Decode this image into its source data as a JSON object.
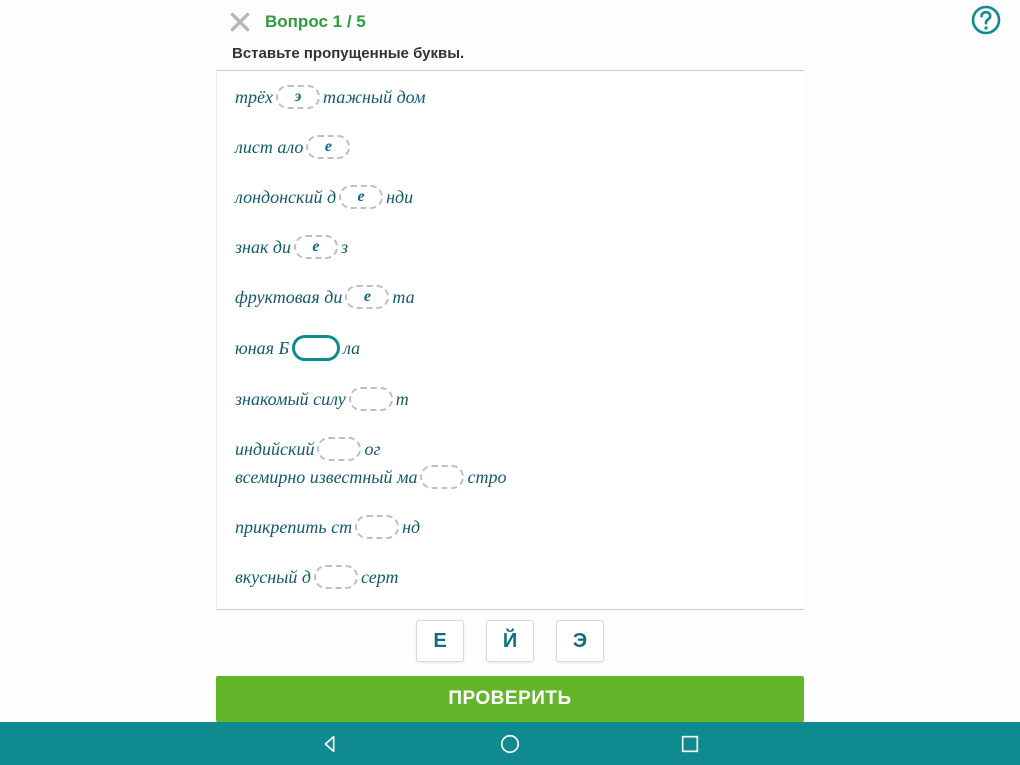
{
  "header": {
    "question_counter": "Вопрос 1 / 5"
  },
  "instruction": "Вставьте пропущенные буквы.",
  "lines": [
    {
      "parts": [
        {
          "t": "text",
          "v": "трёх"
        },
        {
          "t": "blank",
          "v": "э"
        },
        {
          "t": "text",
          "v": "тажный дом"
        }
      ]
    },
    {
      "parts": [
        {
          "t": "text",
          "v": "лист ало"
        },
        {
          "t": "blank",
          "v": "е"
        }
      ]
    },
    {
      "parts": [
        {
          "t": "text",
          "v": "лондонский д"
        },
        {
          "t": "blank",
          "v": "е"
        },
        {
          "t": "text",
          "v": "нди"
        }
      ]
    },
    {
      "parts": [
        {
          "t": "text",
          "v": "знак ди"
        },
        {
          "t": "blank",
          "v": "е"
        },
        {
          "t": "text",
          "v": "з"
        }
      ]
    },
    {
      "parts": [
        {
          "t": "text",
          "v": "фруктовая ди"
        },
        {
          "t": "blank",
          "v": "е"
        },
        {
          "t": "text",
          "v": "та"
        }
      ]
    },
    {
      "parts": [
        {
          "t": "text",
          "v": "юная Б"
        },
        {
          "t": "blank",
          "v": "",
          "active": true
        },
        {
          "t": "text",
          "v": "ла"
        }
      ]
    },
    {
      "parts": [
        {
          "t": "text",
          "v": "знакомый силу"
        },
        {
          "t": "blank",
          "v": ""
        },
        {
          "t": "text",
          "v": "т"
        }
      ]
    },
    {
      "parts": [
        {
          "t": "text",
          "v": "индийский "
        },
        {
          "t": "blank",
          "v": ""
        },
        {
          "t": "text",
          "v": "ог"
        }
      ],
      "tight": true
    },
    {
      "parts": [
        {
          "t": "text",
          "v": "всемирно известный ма"
        },
        {
          "t": "blank",
          "v": ""
        },
        {
          "t": "text",
          "v": "стро"
        }
      ]
    },
    {
      "parts": [
        {
          "t": "text",
          "v": "прикрепить ст"
        },
        {
          "t": "blank",
          "v": ""
        },
        {
          "t": "text",
          "v": "нд"
        }
      ]
    },
    {
      "parts": [
        {
          "t": "text",
          "v": "вкусный д"
        },
        {
          "t": "blank",
          "v": ""
        },
        {
          "t": "text",
          "v": "серт"
        }
      ],
      "last": true
    }
  ],
  "options": [
    "Е",
    "Й",
    "Э"
  ],
  "check_label": "ПРОВЕРИТЬ"
}
